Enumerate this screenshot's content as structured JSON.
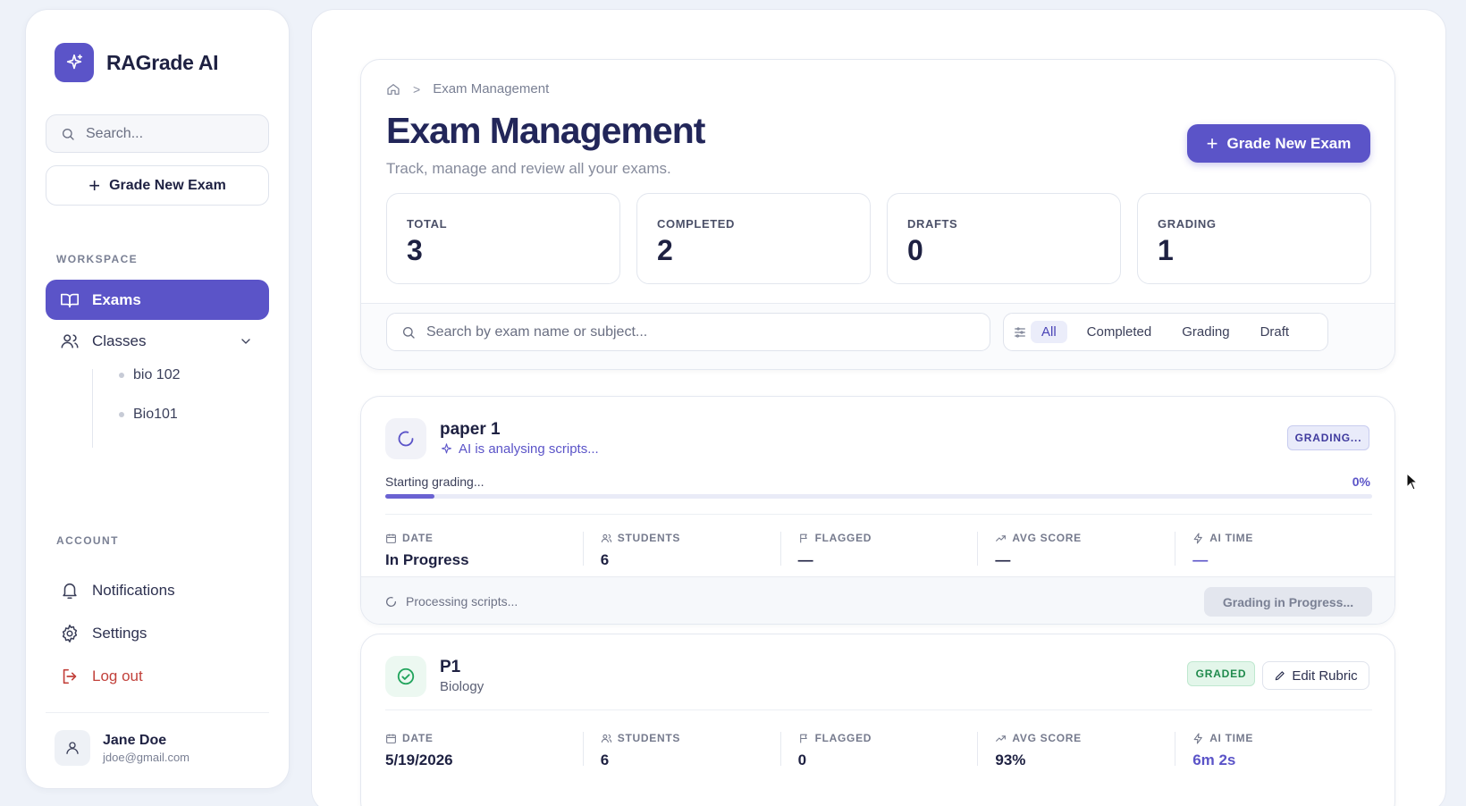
{
  "brand": {
    "name": "RAGrade AI"
  },
  "sidebar": {
    "search_placeholder": "Search...",
    "grade_button": "Grade New Exam",
    "workspace_label": "WORKSPACE",
    "nav": [
      {
        "label": "Exams",
        "icon": "book-open-icon",
        "active": true
      },
      {
        "label": "Classes",
        "icon": "users-icon"
      }
    ],
    "classes": [
      "bio 102",
      "Bio101"
    ],
    "account_label": "ACCOUNT",
    "account": [
      {
        "label": "Notifications",
        "icon": "bell-icon"
      },
      {
        "label": "Settings",
        "icon": "gear-icon"
      },
      {
        "label": "Log out",
        "icon": "logout-icon"
      }
    ],
    "user": {
      "name": "Jane Doe",
      "email": "jdoe@gmail.com"
    }
  },
  "header": {
    "breadcrumb": "Exam Management",
    "title": "Exam Management",
    "subtitle": "Track, manage and review all your exams.",
    "grade_button": "Grade New Exam"
  },
  "stats": [
    {
      "label": "TOTAL",
      "value": "3"
    },
    {
      "label": "COMPLETED",
      "value": "2"
    },
    {
      "label": "DRAFTS",
      "value": "0"
    },
    {
      "label": "GRADING",
      "value": "1"
    }
  ],
  "filters": {
    "search_placeholder": "Search by exam name or subject...",
    "tabs": [
      "All",
      "Completed",
      "Grading",
      "Draft"
    ],
    "active": "All"
  },
  "metric_labels": [
    "DATE",
    "STUDENTS",
    "FLAGGED",
    "AVG SCORE",
    "AI TIME"
  ],
  "exams": [
    {
      "title": "paper 1",
      "subtitle": "AI is analysing scripts...",
      "badge": "GRADING...",
      "progress_label": "Starting grading...",
      "progress_pct": "0%",
      "progress_value": 0.05,
      "metrics": [
        "In Progress",
        "6",
        "—",
        "—",
        "—"
      ],
      "footer_text": "Processing scripts...",
      "footer_button": "Grading in Progress..."
    },
    {
      "title": "P1",
      "subtitle": "Biology",
      "badge": "GRADED",
      "edit_button": "Edit Rubric",
      "metrics": [
        "5/19/2026",
        "6",
        "0",
        "93%",
        "6m 2s"
      ]
    }
  ],
  "colors": {
    "accent": "#5b54c8",
    "success": "#1f8a4c",
    "danger": "#c2413b"
  }
}
